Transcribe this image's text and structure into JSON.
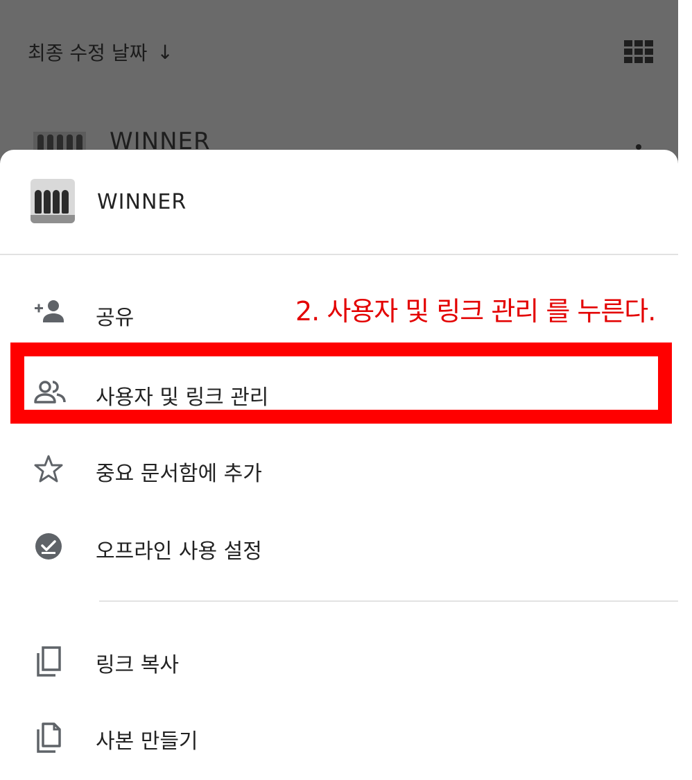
{
  "background": {
    "sort_label": "최종 수정 날짜",
    "sort_arrow": "↓",
    "grid_icon": "grid-view-icon",
    "file_title": "WINNER",
    "more_icon": "more-vert-icon"
  },
  "sheet": {
    "file_title": "WINNER",
    "thumbnail": "group-photo-thumbnail",
    "items": [
      {
        "label": "공유",
        "icon": "person-add-icon"
      },
      {
        "label": "사용자 및 링크 관리",
        "icon": "people-icon"
      },
      {
        "label": "중요 문서함에 추가",
        "icon": "star-outline-icon"
      },
      {
        "label": "오프라인 사용 설정",
        "icon": "offline-check-icon"
      },
      {
        "label": "링크 복사",
        "icon": "copy-link-icon"
      },
      {
        "label": "사본 만들기",
        "icon": "copy-file-icon"
      }
    ]
  },
  "annotation": {
    "text": "2. 사용자 및 링크 관리 를 누른다.",
    "color": "#e30000",
    "box_color": "#ff0000"
  },
  "colors": {
    "scrim": "#6a6a6a",
    "text": "#222222",
    "icon": "#5f6368",
    "divider": "#e2e2e2"
  }
}
